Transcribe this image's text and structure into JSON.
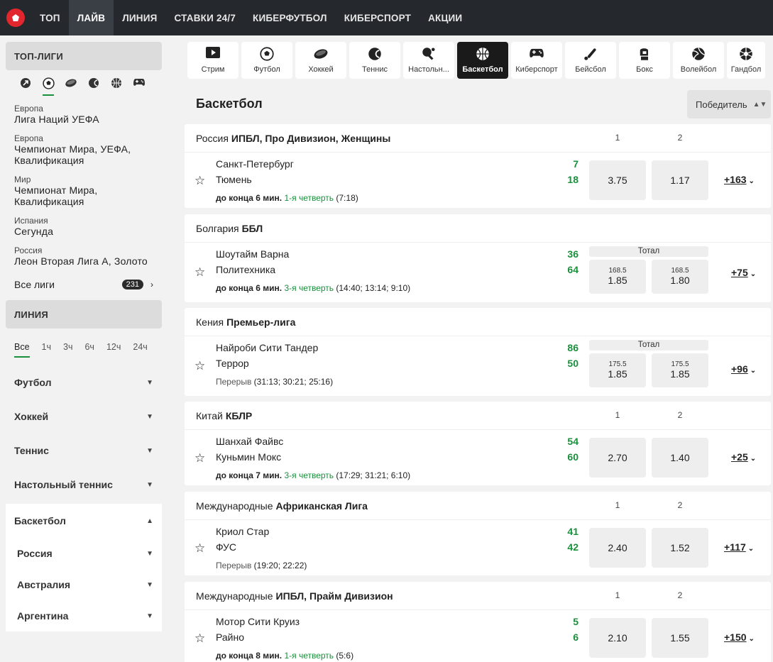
{
  "nav": {
    "items": [
      {
        "label": "ТОП"
      },
      {
        "label": "ЛАЙВ"
      },
      {
        "label": "ЛИНИЯ"
      },
      {
        "label": "СТАВКИ 24/7"
      },
      {
        "label": "КИБЕРФУТБОЛ"
      },
      {
        "label": "КИБЕРСПОРТ"
      },
      {
        "label": "АКЦИИ"
      }
    ],
    "active": "ЛАЙВ"
  },
  "sidebar": {
    "top_leagues_title": "ТОП-ЛИГИ",
    "sport_icons": [
      "rugby-icon",
      "football-icon",
      "hockey-icon",
      "tennis-icon",
      "basketball-icon",
      "esports-icon"
    ],
    "leagues": [
      {
        "region": "Европа",
        "name": "Лига Наций УЕФА"
      },
      {
        "region": "Европа",
        "name": "Чемпионат Мира, УЕФА, Квалификация"
      },
      {
        "region": "Мир",
        "name": "Чемпионат Мира, Квалификация"
      },
      {
        "region": "Испания",
        "name": "Сегунда"
      },
      {
        "region": "Россия",
        "name": "Леон Вторая Лига А, Золото"
      }
    ],
    "all_leagues_label": "Все лиги",
    "all_leagues_count": "231",
    "line_title": "ЛИНИЯ",
    "periods": [
      "Все",
      "1ч",
      "3ч",
      "6ч",
      "12ч",
      "24ч"
    ],
    "sports": [
      "Футбол",
      "Хоккей",
      "Теннис",
      "Настольный теннис"
    ],
    "expanded_sport": "Баскетбол",
    "sub_items": [
      "Россия",
      "Австралия",
      "Аргентина"
    ]
  },
  "sport_tabs": [
    {
      "label": "Стрим",
      "icon": "play-icon"
    },
    {
      "label": "Футбол",
      "icon": "football-icon"
    },
    {
      "label": "Хоккей",
      "icon": "hockey-icon"
    },
    {
      "label": "Теннис",
      "icon": "tennis-icon"
    },
    {
      "label": "Настольн...",
      "icon": "table-tennis-icon"
    },
    {
      "label": "Баскетбол",
      "icon": "basketball-icon"
    },
    {
      "label": "Киберспорт",
      "icon": "gamepad-icon"
    },
    {
      "label": "Бейсбол",
      "icon": "baseball-icon"
    },
    {
      "label": "Бокс",
      "icon": "boxing-icon"
    },
    {
      "label": "Волейбол",
      "icon": "volleyball-icon"
    },
    {
      "label": "Гандбол",
      "icon": "handball-icon"
    }
  ],
  "page_title": "Баскетбол",
  "market_select": "Победитель",
  "blocks": [
    {
      "country": "Россия",
      "league": "ИПБЛ, Про Дивизион, Женщины",
      "col1": "1",
      "col2": "2",
      "team1": "Санкт-Петербург",
      "team2": "Тюмень",
      "score1": "7",
      "score2": "18",
      "remain": "до конца 6 мин.",
      "period": "1-я четверть",
      "detail": "(7:18)",
      "odd1": "3.75",
      "odd2": "1.17",
      "more": "+163"
    },
    {
      "country": "Болгария",
      "league": "ББЛ",
      "col1": "",
      "col2": "",
      "team1": "Шоутайм Варна",
      "team2": "Политехника",
      "score1": "36",
      "score2": "64",
      "remain": "до конца 6 мин.",
      "period": "3-я четверть",
      "detail": "(14:40; 13:14; 9:10)",
      "total_label": "Тотал",
      "line1": "168.5",
      "line2": "168.5",
      "odd1": "1.85",
      "odd2": "1.80",
      "more": "+75"
    },
    {
      "country": "Кения",
      "league": "Премьер-лига",
      "col1": "",
      "col2": "",
      "team1": "Найроби Сити Тандер",
      "team2": "Террор",
      "score1": "86",
      "score2": "50",
      "remain": "",
      "period": "Перерыв",
      "detail": "(31:13; 30:21; 25:16)",
      "total_label": "Тотал",
      "line1": "175.5",
      "line2": "175.5",
      "odd1": "1.85",
      "odd2": "1.85",
      "more": "+96"
    },
    {
      "country": "Китай",
      "league": "КБЛР",
      "col1": "1",
      "col2": "2",
      "team1": "Шанхай Файвс",
      "team2": "Куньмин Мокс",
      "score1": "54",
      "score2": "60",
      "remain": "до конца 7 мин.",
      "period": "3-я четверть",
      "detail": "(17:29; 31:21; 6:10)",
      "odd1": "2.70",
      "odd2": "1.40",
      "more": "+25"
    },
    {
      "country": "Международные",
      "league": "Африканская Лига",
      "col1": "1",
      "col2": "2",
      "team1": "Криол Стар",
      "team2": "ФУС",
      "score1": "41",
      "score2": "42",
      "remain": "",
      "period": "Перерыв",
      "detail": "(19:20; 22:22)",
      "odd1": "2.40",
      "odd2": "1.52",
      "more": "+117"
    },
    {
      "country": "Международные",
      "league": "ИПБЛ, Прайм Дивизион",
      "col1": "1",
      "col2": "2",
      "team1": "Мотор Сити Круиз",
      "team2": "Райно",
      "score1": "5",
      "score2": "6",
      "remain": "до конца 8 мин.",
      "period": "1-я четверть",
      "detail": "(5:6)",
      "odd1": "2.10",
      "odd2": "1.55",
      "more": "+150"
    }
  ],
  "colors": {
    "accent": "#1a8f3c",
    "topbar": "#25282d",
    "logo": "#e2262e"
  }
}
